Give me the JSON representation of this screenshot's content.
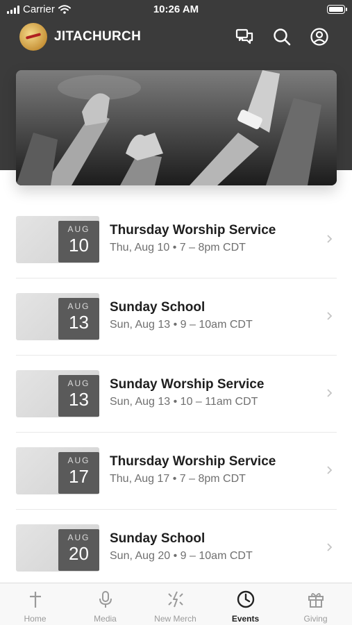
{
  "status_bar": {
    "carrier": "Carrier",
    "time": "10:26 AM"
  },
  "app_bar": {
    "brand": "JITACHURCH"
  },
  "events": [
    {
      "month": "AUG",
      "day": "10",
      "title": "Thursday Worship Service",
      "subtitle": "Thu, Aug 10 • 7 – 8pm CDT"
    },
    {
      "month": "AUG",
      "day": "13",
      "title": "Sunday School",
      "subtitle": "Sun, Aug 13 • 9 – 10am CDT"
    },
    {
      "month": "AUG",
      "day": "13",
      "title": "Sunday Worship Service",
      "subtitle": "Sun, Aug 13 • 10 – 11am CDT"
    },
    {
      "month": "AUG",
      "day": "17",
      "title": "Thursday Worship Service",
      "subtitle": "Thu, Aug 17 • 7 – 8pm CDT"
    },
    {
      "month": "AUG",
      "day": "20",
      "title": "Sunday School",
      "subtitle": "Sun, Aug 20 • 9 – 10am CDT"
    }
  ],
  "tabs": [
    {
      "label": "Home",
      "icon": "cross-icon"
    },
    {
      "label": "Media",
      "icon": "microphone-icon"
    },
    {
      "label": "New Merch",
      "icon": "sparkle-icon"
    },
    {
      "label": "Events",
      "icon": "clock-icon",
      "active": true
    },
    {
      "label": "Giving",
      "icon": "gift-icon"
    }
  ]
}
